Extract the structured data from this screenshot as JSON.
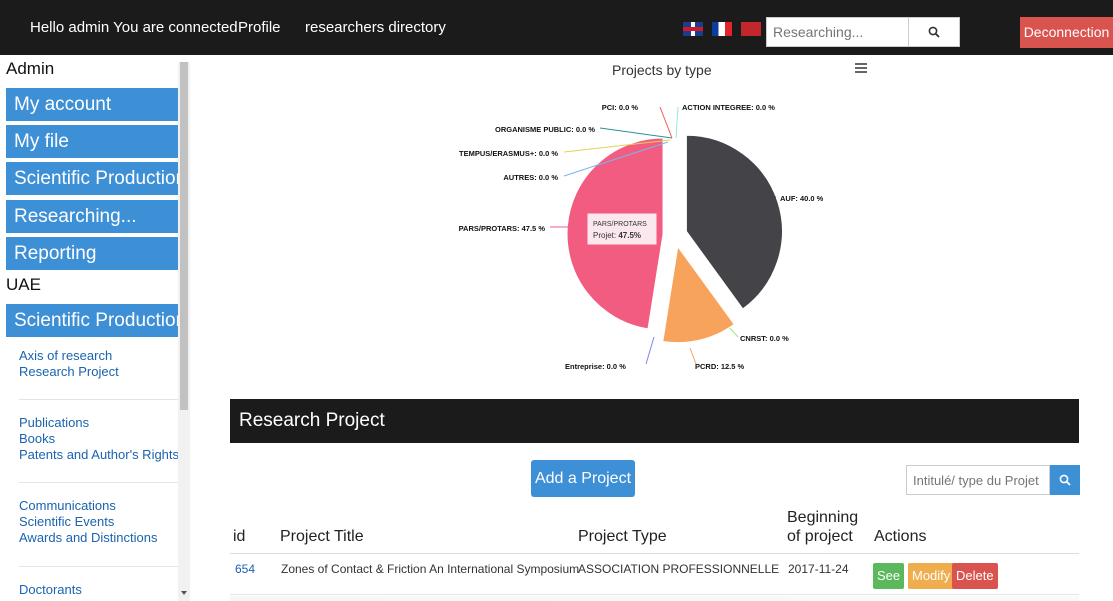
{
  "navbar": {
    "greeting": "Hello admin You are connected",
    "profile": "Profile",
    "directory": "researchers directory",
    "search_placeholder": "Researching...",
    "logout": "Deconnection"
  },
  "sidebar": {
    "section1": "Admin",
    "buttons1": [
      "My account",
      "My file",
      "Scientific Production",
      "Researching...",
      "Reporting"
    ],
    "section2": "UAE",
    "button2": "Scientific Production",
    "groups": [
      [
        "Axis of research",
        "Research Project"
      ],
      [
        "Publications",
        "Books",
        "Patents and Author's Rights"
      ],
      [
        "Communications",
        "Scientific Events",
        "Awards and Distinctions"
      ],
      [
        "Doctorants"
      ]
    ]
  },
  "chart": {
    "title": "Projects by type",
    "tooltip": {
      "label": "PARS/PROTARS",
      "prefix": "Projet: ",
      "value": "47.5%"
    }
  },
  "chart_data": {
    "type": "pie",
    "title": "Projects by type",
    "slices": [
      {
        "name": "AUF",
        "value": 40.0,
        "label": "AUF: 40.0 %",
        "color": "#434348"
      },
      {
        "name": "CNRST",
        "value": 0.0,
        "label": "CNRST: 0.0 %",
        "color": "#90ed7d"
      },
      {
        "name": "PCRD",
        "value": 12.5,
        "label": "PCRD: 12.5 %",
        "color": "#f7a35c"
      },
      {
        "name": "Entreprise",
        "value": 0.0,
        "label": "Entreprise: 0.0 %",
        "color": "#8085e9"
      },
      {
        "name": "PARS/PROTARS",
        "value": 47.5,
        "label": "PARS/PROTARS: 47.5 %",
        "color": "#f15c80"
      },
      {
        "name": "AUTRES",
        "value": 0.0,
        "label": "AUTRES: 0.0 %",
        "color": "#7cb5ec"
      },
      {
        "name": "TEMPUS/ERASMUS+",
        "value": 0.0,
        "label": "TEMPUS/ERASMUS+: 0.0 %",
        "color": "#e4d354"
      },
      {
        "name": "ORGANISME PUBLIC",
        "value": 0.0,
        "label": "ORGANISME PUBLIC: 0.0 %",
        "color": "#2b908f"
      },
      {
        "name": "PCI",
        "value": 0.0,
        "label": "PCI: 0.0 %",
        "color": "#f45b5b"
      },
      {
        "name": "ACTION INTEGREE",
        "value": 0.0,
        "label": "ACTION INTEGREE: 0.0 %",
        "color": "#91e8e1"
      }
    ]
  },
  "research": {
    "header": "Research Project",
    "add_button": "Add a Project",
    "filter_placeholder": "Intitulé/ type du Projet",
    "columns": [
      "id",
      "Project Title",
      "Project Type",
      "Beginning",
      "of project",
      "Actions"
    ],
    "rows": [
      {
        "id": "654",
        "title": "Zones of Contact & Friction An International Symposium",
        "type": "ASSOCIATION PROFESSIONNELLE",
        "date": "2017-11-24",
        "actions": [
          "See",
          "Modify",
          "Delete"
        ]
      }
    ]
  }
}
